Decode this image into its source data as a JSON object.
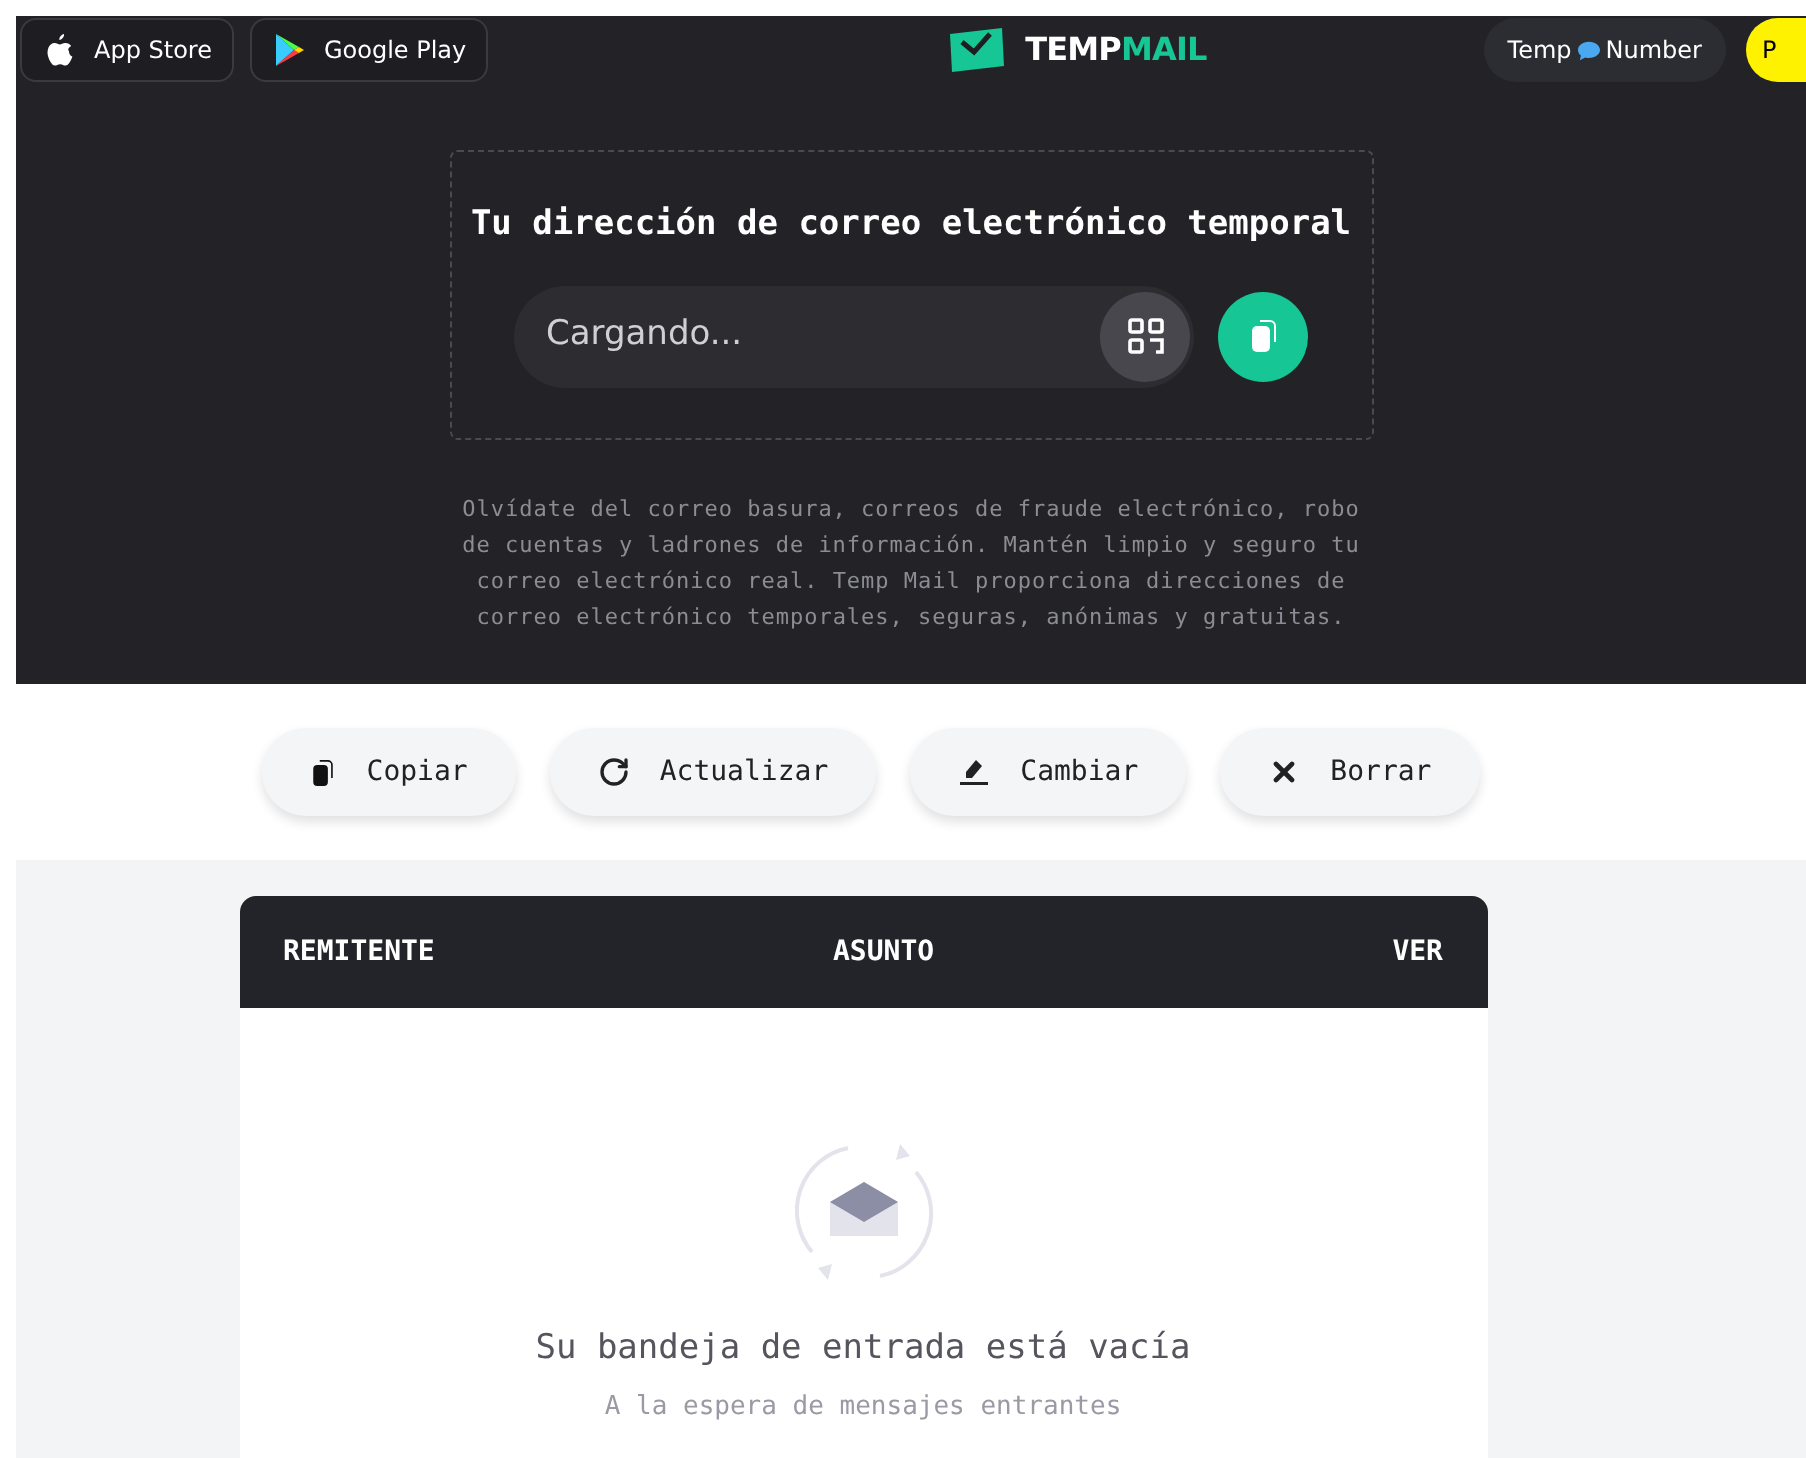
{
  "topbar": {
    "store_links": [
      {
        "kind": "apple",
        "label": "App Store"
      },
      {
        "kind": "play",
        "label": "Google Play"
      }
    ],
    "logo": {
      "first": "TEMP",
      "second": "MAIL"
    },
    "number_button": {
      "before": "Temp",
      "after": "Number"
    },
    "profile": {
      "label": "P"
    }
  },
  "hero": {
    "title": "Tu dirección de correo electrónico temporal",
    "email_field": {
      "placeholder": "Cargando..."
    },
    "description": "Olvídate del correo basura, correos de fraude electrónico, robo de cuentas y ladrones de información. Mantén limpio y seguro tu correo electrónico real. Temp Mail proporciona direcciones de correo electrónico temporales, seguras, anónimas y gratuitas."
  },
  "actions": [
    {
      "kind": "copy",
      "label": "Copiar"
    },
    {
      "kind": "refresh",
      "label": "Actualizar"
    },
    {
      "kind": "change",
      "label": "Cambiar"
    },
    {
      "kind": "delete",
      "label": "Borrar"
    }
  ],
  "inbox": {
    "columns": [
      "REMITENTE",
      "ASUNTO",
      "VER"
    ],
    "empty_title": "Su bandeja de entrada está vacía",
    "empty_subtitle": "A la espera de mensajes entrantes"
  }
}
